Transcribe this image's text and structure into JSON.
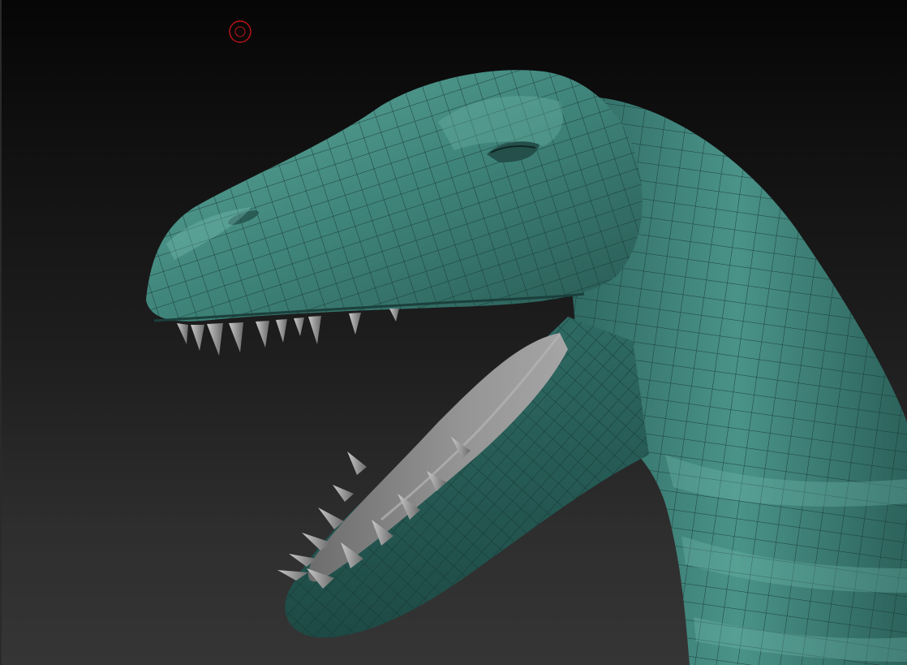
{
  "viewport": {
    "background_top": "#060606",
    "background_bottom": "#353535"
  },
  "model": {
    "subject": "dinosaur-head-wireframe",
    "skin_color": "#3a7a72",
    "skin_light": "#5aa397",
    "skin_dark": "#1f4944",
    "wire_color": "#163532",
    "tooth_color": "#9a9a9a",
    "mouth_color": "#7a7a7a"
  },
  "cursor": {
    "icon": "brush-circle-icon",
    "color": "#c0141a"
  }
}
